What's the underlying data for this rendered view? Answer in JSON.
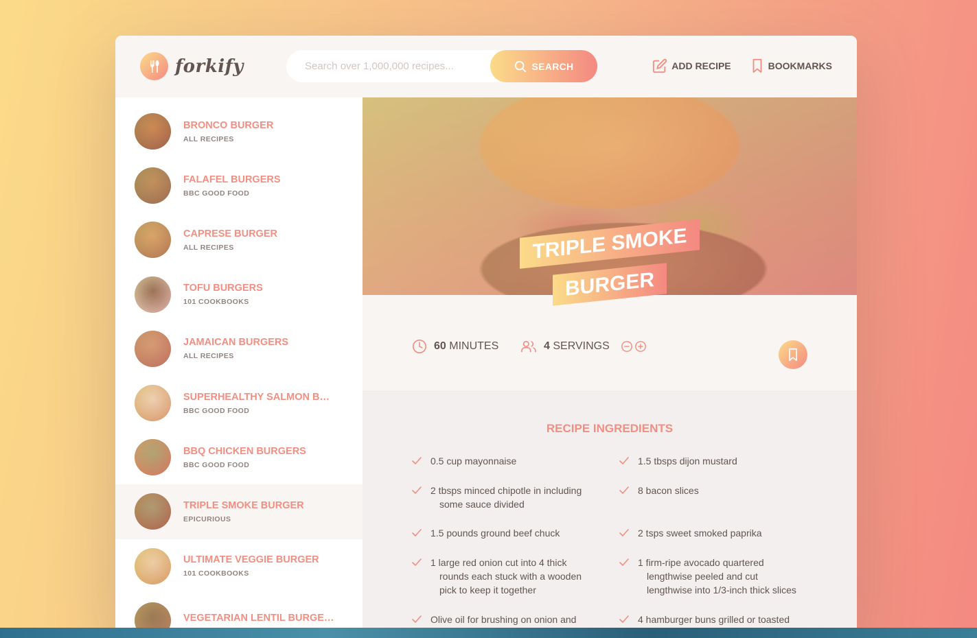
{
  "header": {
    "logo_text": "forkify",
    "search_placeholder": "Search over 1,000,000 recipes...",
    "search_button": "SEARCH",
    "nav": {
      "add_recipe": "ADD RECIPE",
      "bookmarks": "BOOKMARKS"
    }
  },
  "results": [
    {
      "title": "BRONCO BURGER",
      "publisher": "ALL RECIPES",
      "colors": [
        "#b5703a",
        "#6e4a2e"
      ]
    },
    {
      "title": "FALAFEL BURGERS",
      "publisher": "BBC GOOD FOOD",
      "colors": [
        "#a67c45",
        "#6b5a3a"
      ]
    },
    {
      "title": "CAPRESE BURGER",
      "publisher": "ALL RECIPES",
      "colors": [
        "#c99a5a",
        "#8a6a3a"
      ]
    },
    {
      "title": "TOFU BURGERS",
      "publisher": "101 COOKBOOKS",
      "colors": [
        "#6b4e3e",
        "#d8cfc2"
      ]
    },
    {
      "title": "JAMAICAN BURGERS",
      "publisher": "ALL RECIPES",
      "colors": [
        "#c48a6a",
        "#a05e4a"
      ]
    },
    {
      "title": "SUPERHEALTHY SALMON BURGER",
      "publisher": "BBC GOOD FOOD",
      "colors": [
        "#e8dcc8",
        "#c89a5a"
      ]
    },
    {
      "title": "BBQ CHICKEN BURGERS",
      "publisher": "BBC GOOD FOOD",
      "colors": [
        "#8a9a6a",
        "#c86a4a"
      ]
    },
    {
      "title": "TRIPLE SMOKE BURGER",
      "publisher": "EPICURIOUS",
      "colors": [
        "#8a8a6a",
        "#8a4a2a"
      ]
    },
    {
      "title": "ULTIMATE VEGGIE BURGER",
      "publisher": "101 COOKBOOKS",
      "colors": [
        "#e8d8b8",
        "#c8a04a"
      ]
    },
    {
      "title": "VEGETARIAN LENTIL BURGERS",
      "publisher": "",
      "colors": [
        "#6a5a3a",
        "#a08050"
      ]
    }
  ],
  "active_result_index": 7,
  "recipe": {
    "title_line1": "TRIPLE SMOKE",
    "title_line2": "BURGER",
    "time_value": "60",
    "time_unit": "MINUTES",
    "servings_value": "4",
    "servings_unit": "SERVINGS",
    "ingredients_heading": "RECIPE INGREDIENTS",
    "ingredients": [
      {
        "line1": "0.5 cup mayonnaise",
        "cont": []
      },
      {
        "line1": "1.5 tbsps dijon mustard",
        "cont": []
      },
      {
        "line1": "2 tbsps minced chipotle in including",
        "cont": [
          "some sauce divided"
        ]
      },
      {
        "line1": "8 bacon slices",
        "cont": []
      },
      {
        "line1": "1.5 pounds ground beef chuck",
        "cont": []
      },
      {
        "line1": "2 tsps sweet smoked paprika",
        "cont": []
      },
      {
        "line1": "1 large red onion cut into 4 thick",
        "cont": [
          "rounds each stuck with a wooden",
          "pick to keep it together"
        ]
      },
      {
        "line1": "1 firm-ripe avocado quartered",
        "cont": [
          "lengthwise peeled and cut",
          "lengthwise into 1/3-inch thick slices"
        ]
      },
      {
        "line1": " Olive oil for brushing on onion and",
        "cont": []
      },
      {
        "line1": "4 hamburger buns grilled or toasted",
        "cont": []
      }
    ]
  },
  "colors": {
    "accent": "#f38e82",
    "gradient_start": "#fbdb89",
    "gradient_end": "#f48982",
    "text": "#615551"
  }
}
